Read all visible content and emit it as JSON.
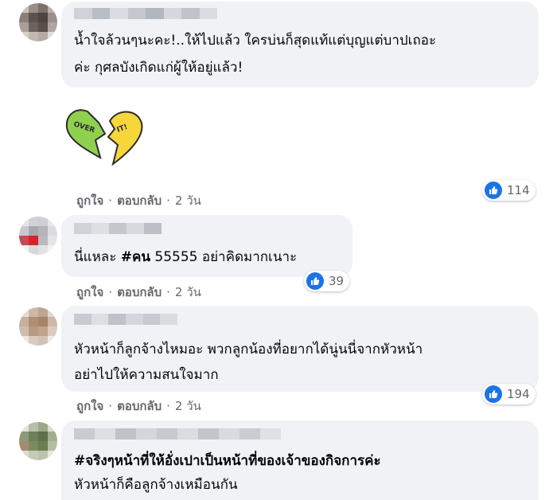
{
  "comments": [
    {
      "text_lines": [
        "น้ำใจล้วนๆนะคะ!..ให้ไปแล้ว ใครบ่นก็สุดแท้แต่บุญแต่บาปเถอะ",
        "ค่ะ กุศลบังเกิดแก่ผู้ให้อยู่แล้ว!"
      ],
      "sticker_left": "OVER",
      "sticker_right": "IT!",
      "like": "ถูกใจ",
      "reply": "ตอบกลับ",
      "time": "2 วัน",
      "reactions": "114"
    },
    {
      "prefix": "นี่แหละ ",
      "hashtag": "#คน",
      "suffix": " 55555 อย่าคิดมากเนาะ",
      "like": "ถูกใจ",
      "reply": "ตอบกลับ",
      "time": "2 วัน",
      "reactions": "39"
    },
    {
      "text_lines": [
        "หัวหน้าก็ลูกจ้างไหมอะ พวกลูกน้องที่อยากได้นู่นนี่จากหัวหน้า",
        "อย่าไปให้ความสนใจมาก"
      ],
      "like": "ถูกใจ",
      "reply": "ตอบกลับ",
      "time": "2 วัน",
      "reactions": "194"
    },
    {
      "hashtag_line": "#จริงๆหน้าที่ให้อั่งเปาเป็นหน้าที่ของเจ้าของกิจการค่ะ",
      "text_line": "หัวหน้าก็คือลูกจ้างเหมือนกัน"
    }
  ],
  "colors": {
    "bubble": "#f0f2f5",
    "like_blue": "#1b74e4",
    "meta_gray": "#65676b",
    "sticker_green": "#8fd14f",
    "sticker_yellow": "#f7d63c"
  },
  "icons": {
    "reaction": "thumbs-up-icon"
  }
}
